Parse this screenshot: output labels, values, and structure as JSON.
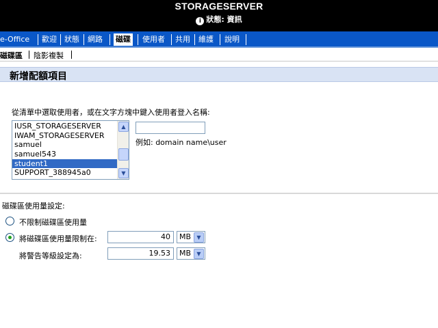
{
  "header": {
    "server_name": "STORAGESERVER",
    "status_label": "狀態: 資訊",
    "status_icon": "info-icon"
  },
  "nav": {
    "items": [
      {
        "label": "e-Office"
      },
      {
        "label": "歡迎"
      },
      {
        "label": "狀態"
      },
      {
        "label": "網路"
      },
      {
        "label": "磁碟",
        "active": true
      },
      {
        "label": "使用者"
      },
      {
        "label": "共用"
      },
      {
        "label": "維護"
      },
      {
        "label": "說明"
      }
    ]
  },
  "subnav": {
    "items": [
      {
        "label": "磁碟區",
        "active": true
      },
      {
        "label": "陰影複製"
      }
    ]
  },
  "page": {
    "title": "新增配額項目",
    "instruction": "從清單中選取使用者，或在文字方塊中鍵入使用者登入名稱:",
    "example": "例如: domain name\\user",
    "username_value": ""
  },
  "users": {
    "items": [
      "IUSR_STORAGESERVER",
      "IWAM_STORAGESERVER",
      "samuel",
      "samuel543",
      "student1",
      "SUPPORT_388945a0"
    ],
    "selected": "student1"
  },
  "quota": {
    "section_label": "磁碟區使用量設定:",
    "no_limit_label": "不限制磁碟區使用量",
    "limit_label": "將磁碟區使用量限制在:",
    "limit_value": "40",
    "limit_unit": "MB",
    "warning_label": "將警告等級設定為:",
    "warning_value": "19.53",
    "warning_unit": "MB",
    "selected_option": "limit"
  },
  "colors": {
    "nav_bg": "#0a57c7",
    "title_bg": "#d9e3f4",
    "selection": "#316ac5",
    "radio_dot": "#21a121"
  }
}
